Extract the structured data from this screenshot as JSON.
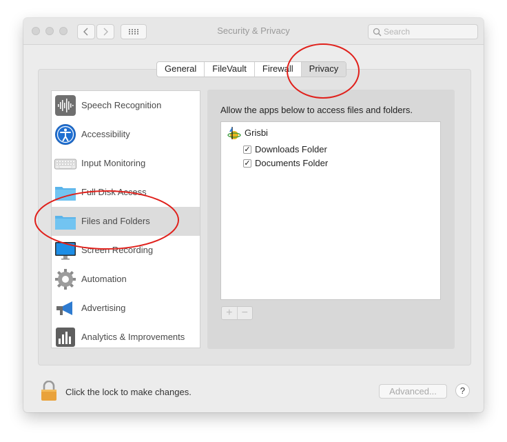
{
  "window": {
    "title": "Security & Privacy",
    "search_placeholder": "Search"
  },
  "tabs": [
    {
      "label": "General"
    },
    {
      "label": "FileVault"
    },
    {
      "label": "Firewall"
    },
    {
      "label": "Privacy",
      "selected": true
    }
  ],
  "sidebar": {
    "items": [
      {
        "label": "Speech Recognition",
        "icon": "waveform-icon"
      },
      {
        "label": "Accessibility",
        "icon": "accessibility-icon"
      },
      {
        "label": "Input Monitoring",
        "icon": "keyboard-icon"
      },
      {
        "label": "Full Disk Access",
        "icon": "folder-icon"
      },
      {
        "label": "Files and Folders",
        "icon": "folder-icon",
        "selected": true
      },
      {
        "label": "Screen Recording",
        "icon": "display-icon"
      },
      {
        "label": "Automation",
        "icon": "gear-icon"
      },
      {
        "label": "Advertising",
        "icon": "megaphone-icon"
      },
      {
        "label": "Analytics & Improvements",
        "icon": "bar-chart-icon"
      }
    ]
  },
  "panel": {
    "description": "Allow the apps below to access files and folders.",
    "app": {
      "name": "Grisbi",
      "permissions": [
        {
          "label": "Downloads Folder",
          "checked": true,
          "check_glyph": "✓"
        },
        {
          "label": "Documents Folder",
          "checked": true,
          "check_glyph": "✓"
        }
      ]
    },
    "add_label": "+",
    "remove_label": "−"
  },
  "footer": {
    "lock_text": "Click the lock to make changes.",
    "advanced_label": "Advanced...",
    "help_label": "?"
  },
  "colors": {
    "annotation": "#e0201b",
    "folder": "#6cc0ef",
    "selected_row": "#dcdcdc"
  }
}
